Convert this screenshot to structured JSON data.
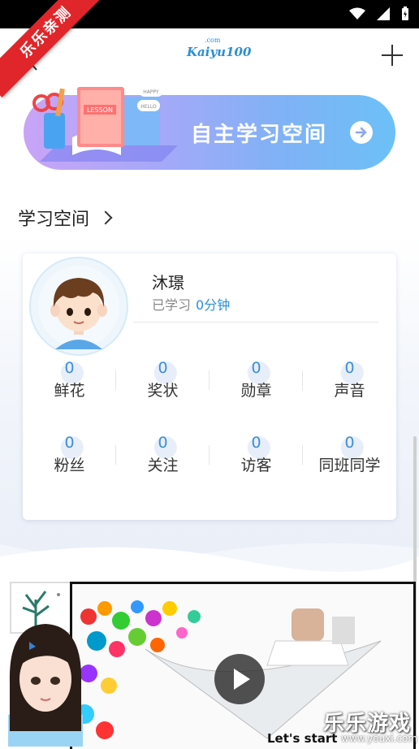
{
  "ribbon": "乐乐亲测",
  "header": {
    "logo_main": "Kaiyu100",
    "logo_sup": ".com"
  },
  "banner": {
    "title": "自主学习空间",
    "book_label": "LESSON",
    "bubble1": "HAPPY",
    "bubble2": "HELLO"
  },
  "section": {
    "title": "学习空间"
  },
  "profile": {
    "name": "沐璟",
    "study_label": "已学习",
    "study_time": "0分钟"
  },
  "stats": [
    [
      {
        "value": "0",
        "label": "鲜花"
      },
      {
        "value": "0",
        "label": "奖状"
      },
      {
        "value": "0",
        "label": "勋章"
      },
      {
        "value": "0",
        "label": "声音"
      }
    ],
    [
      {
        "value": "0",
        "label": "粉丝"
      },
      {
        "value": "0",
        "label": "关注"
      },
      {
        "value": "0",
        "label": "访客"
      },
      {
        "value": "0",
        "label": "同班同学"
      }
    ]
  ],
  "video": {
    "caption": "Let's start"
  },
  "watermark": {
    "text": "乐乐游戏",
    "url": "www.youxi.com"
  },
  "colors": {
    "accent": "#3b8fd8",
    "ribbon": "#e0262a"
  }
}
